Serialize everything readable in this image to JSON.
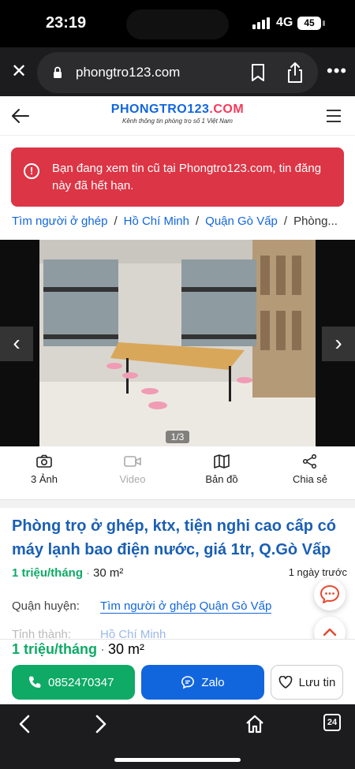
{
  "status_bar": {
    "time": "23:19",
    "network": "4G",
    "battery": "45"
  },
  "browser": {
    "url": "phongtro123.com",
    "tabs_count": "24"
  },
  "site": {
    "logo_main": "PHONGTRO123",
    "logo_tld": ".COM",
    "tagline": "Kênh thông tin phòng trọ số 1 Việt Nam"
  },
  "alert": {
    "text": "Bạn đang xem tin cũ tại Phongtro123.com, tin đăng này đã hết hạn.",
    "icon": "!"
  },
  "breadcrumb": [
    {
      "label": "Tìm người ở ghép"
    },
    {
      "label": "Hồ Chí Minh"
    },
    {
      "label": "Quận Gò Vấp"
    },
    {
      "label": "Phòng..."
    }
  ],
  "gallery": {
    "counter": "1/3"
  },
  "tools": [
    {
      "label": "3 Ảnh",
      "icon": "camera-icon"
    },
    {
      "label": "Video",
      "icon": "video-icon"
    },
    {
      "label": "Bản đồ",
      "icon": "map-icon"
    },
    {
      "label": "Chia sẻ",
      "icon": "share-icon"
    }
  ],
  "listing": {
    "title": "Phòng trọ ở ghép, ktx, tiện nghi cao cấp có máy lạnh bao điện nước, giá 1tr, Q.Gò Vấp",
    "price": "1 triệu/tháng",
    "area": "30 m²",
    "posted": "1 ngày trước",
    "district_label": "Quận huyện:",
    "district_value": "Tìm người ở ghép Quận Gò Vấp",
    "city_label": "Tỉnh thành:",
    "city_value": "Hồ Chí Minh"
  },
  "actions": {
    "phone": "0852470347",
    "zalo": "Zalo",
    "save": "Lưu tin"
  },
  "colors": {
    "brand_blue": "#1266dd",
    "alert_red": "#dc3545",
    "price_green": "#0eaa66"
  }
}
